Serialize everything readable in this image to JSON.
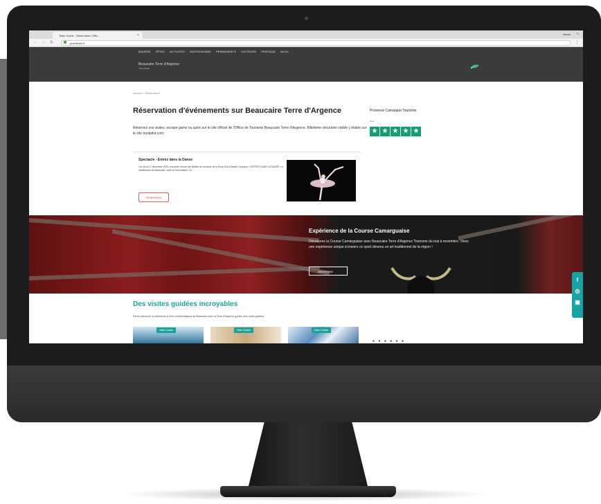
{
  "browser": {
    "tab_title": "Bwin Guest - Réservation Offic...",
    "tab_close": "×",
    "user_name": "Name",
    "url": "pushflowe.fr",
    "back": "←",
    "forward": "→",
    "reload": "↻",
    "menu": "⋮",
    "extension": "✎"
  },
  "site": {
    "nav": [
      "BOURSE",
      "FÊTES",
      "ACTIVITÉS",
      "GASTRONOMIE",
      "PERMANENTS",
      "VISITEURS",
      "PRATIQUE",
      "BLOG"
    ],
    "logo_line1": "Beaucaire Terre d'Argence",
    "logo_line2": "Tourisme",
    "breadcrumb": "Accueil > Réservation",
    "title": "Réservation d'événements sur Beaucaire Terre d'Argence",
    "intro": "Réservez vos visites, escape game ou autre sur le site officiel de l'Office de Tourisme Beaucaire Terre d'Argence. Billetterie sécurisée visible y étalée sur le site trustpilot.com.",
    "card": {
      "title": "Spectacle - Entrez dans la Danse",
      "text": "Les 16 et 17 décembre 2023, retrouvez l'école des Ballets de la danse de la Rose Sud & Ballet Company « ENTREZ DANS LA DANSE » à l'Auditorium de Beaucaire, salle de l'Incendiaire, 14.",
      "button": "RÉSERVER"
    },
    "sidebar": {
      "title": "Provence Camargue Tourisme",
      "note": "Note",
      "stars": [
        "★",
        "★",
        "★",
        "★",
        "★"
      ]
    },
    "hero": {
      "title": "Expérience de la Course Camarguaise",
      "text": "Découvrez la Course Camarguaise avec Beaucaire Terre d'Argence Tourisme du mai à novembre. Vivez une expérience unique à travers ce sport devenu un art traditionnel de la région !",
      "button": "RÉSERVER"
    },
    "social": [
      "f",
      "◎",
      "▣"
    ],
    "section": {
      "title": "Des visites guidées incroyables",
      "subtitle": "Partez découvrir le patrimoine le lieux emblématiques de Beaucaire avec la Terre d'Argence guidée avec visite guidées.",
      "thumbs": [
        {
          "badge": "Visite Guidée"
        },
        {
          "badge": "Visite Guidée"
        },
        {
          "badge": "Visite Guidée"
        }
      ],
      "dots": "● ● ● ● ● ●"
    }
  },
  "colors": {
    "accent": "#1ba39a",
    "trustpilot": "#14a06a",
    "header": "#3b3b3b",
    "button_border": "#e05a5a"
  }
}
